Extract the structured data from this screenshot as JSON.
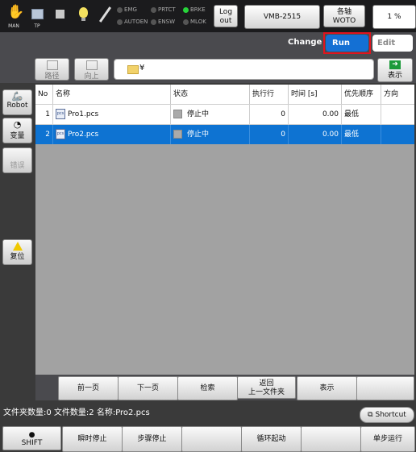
{
  "topbar": {
    "icons": [
      {
        "name": "hand-icon",
        "caption": "MAN"
      },
      {
        "name": "teach-pendant-icon",
        "caption": "TP"
      },
      {
        "name": "square-icon",
        "caption": ""
      },
      {
        "name": "lightbulb-icon",
        "caption": ""
      },
      {
        "name": "wrench-icon",
        "caption": ""
      }
    ],
    "indicators": {
      "emg": "EMG",
      "autoen": "AUTOEN",
      "prtct": "PRTCT",
      "ensw": "ENSW",
      "brke": "BRKE",
      "mlok": "MLOK"
    },
    "logout_label": "Log out",
    "robot_model": "VMB-2515",
    "axis_label": "各轴 WOTO",
    "speed": "1 %",
    "colors": {
      "indicator_on": "#27d33a",
      "indicator_off": "#555555"
    }
  },
  "mode": {
    "change_label": "Change",
    "run_label": "Run",
    "edit_label": "Edit",
    "colors": {
      "run": "#1470d4",
      "highlight_frame": "#e0141e"
    }
  },
  "toolbar": {
    "path_label": "路径",
    "up_label": "向上",
    "current_path": "¥",
    "show_label": "表示"
  },
  "side": {
    "robot_label": "Robot",
    "variable_label": "变量",
    "error_label": "错误",
    "reset_label": "复位"
  },
  "table": {
    "columns": [
      "No",
      "名称",
      "状态",
      "执行行",
      "时间 [s]",
      "优先顺序",
      "方向"
    ],
    "rows": [
      {
        "no": "1",
        "name": "Pro1.pcs",
        "status": "停止中",
        "line": "0",
        "time": "0.00",
        "priority": "最低",
        "direction": "",
        "selected": false
      },
      {
        "no": "2",
        "name": "Pro2.pcs",
        "status": "停止中",
        "line": "0",
        "time": "0.00",
        "priority": "最低",
        "direction": "",
        "selected": true
      }
    ],
    "colors": {
      "selected_row": "#0e73d2",
      "empty_area": "#a2a2a2"
    }
  },
  "nav": {
    "prev_label": "前一页",
    "next_label": "下一页",
    "search_label": "检索",
    "back_line1": "返回",
    "back_line2": "上一文件夹",
    "show_label": "表示",
    "empty_label": ""
  },
  "status": {
    "text": "文件夹数量:0  文件数量:2  名称:Pro2.pcs",
    "shortcut_label": "Shortcut"
  },
  "functions": {
    "shift_label": "SHIFT",
    "instant_stop_label": "瞬时停止",
    "step_stop_label": "步骤停止",
    "empty1": "",
    "loop_start_label": "循环起动",
    "empty2": "",
    "step_run_label": "单步运行"
  }
}
